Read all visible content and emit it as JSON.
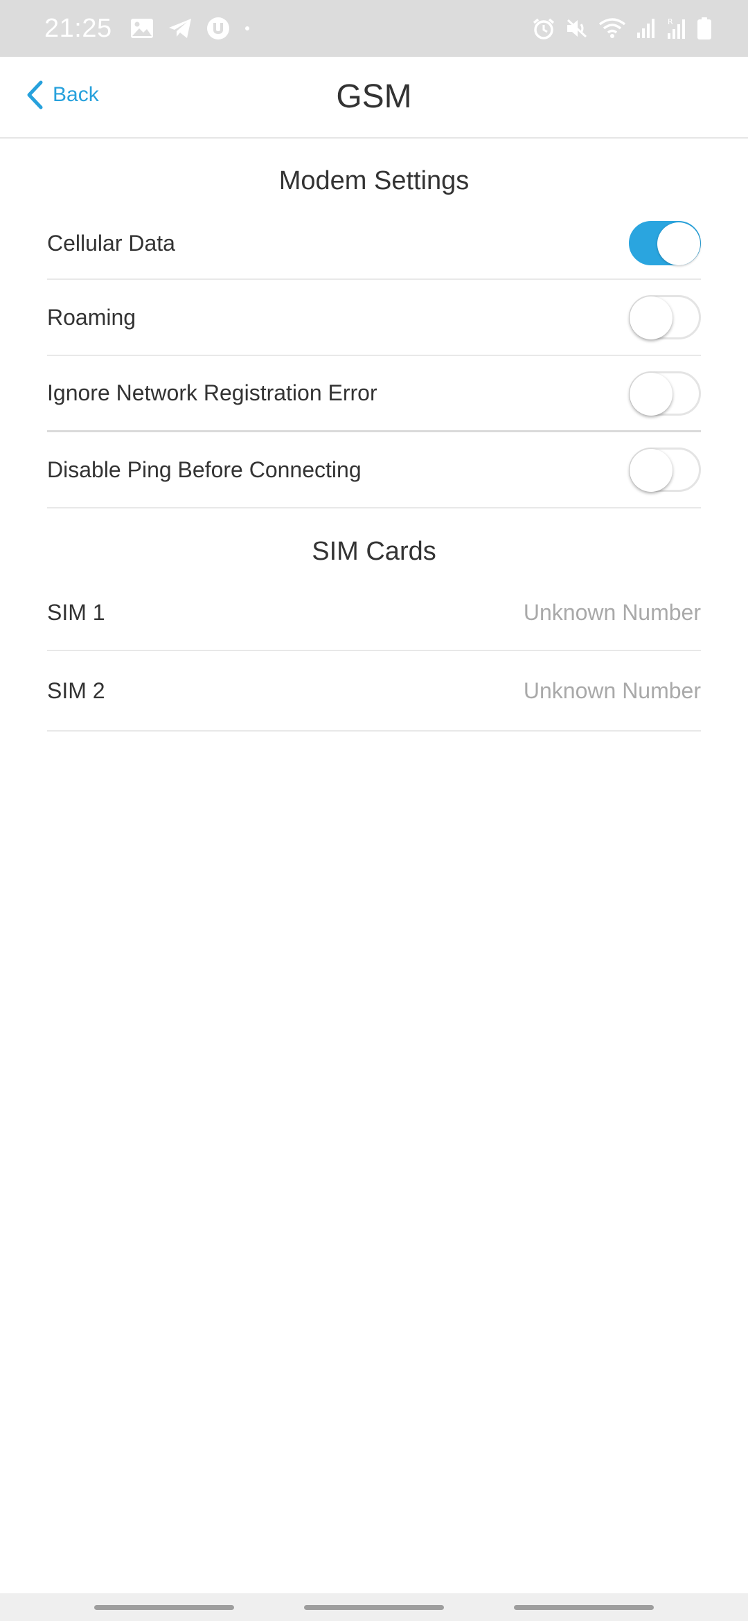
{
  "status_bar": {
    "time": "21:25",
    "left_icons": [
      "image-icon",
      "telegram-icon",
      "utorrent-icon",
      "dot-icon"
    ],
    "right_icons": [
      "alarm-icon",
      "mute-icon",
      "wifi-icon",
      "signal-icon",
      "signal-roaming-icon",
      "battery-icon"
    ],
    "roaming_label": "R"
  },
  "nav": {
    "back_label": "Back",
    "title": "GSM"
  },
  "modem_settings": {
    "header": "Modem Settings",
    "items": [
      {
        "label": "Cellular Data",
        "enabled": true
      },
      {
        "label": "Roaming",
        "enabled": false
      },
      {
        "label": "Ignore Network Registration Error",
        "enabled": false
      },
      {
        "label": "Disable Ping Before Connecting",
        "enabled": false
      }
    ]
  },
  "sim_cards": {
    "header": "SIM Cards",
    "items": [
      {
        "label": "SIM 1",
        "value": "Unknown Number"
      },
      {
        "label": "SIM 2",
        "value": "Unknown Number"
      }
    ]
  },
  "colors": {
    "accent": "#27a1dc",
    "toggle_on": "#2aa5df",
    "status_bar_bg": "#dcdcdc",
    "secondary_text": "#a9a9a9"
  }
}
